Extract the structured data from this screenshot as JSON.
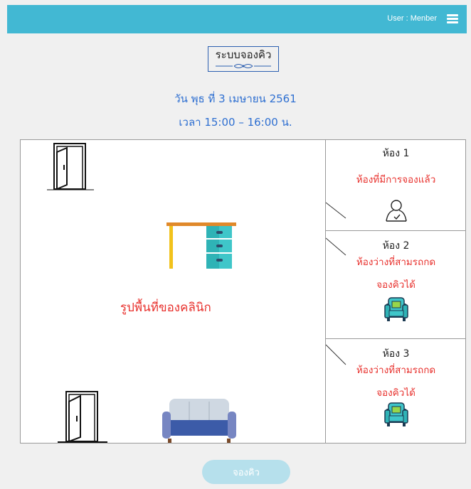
{
  "header": {
    "user_label": "User : Menber",
    "menu_icon": "hamburger-icon"
  },
  "title": "ระบบจองคิว",
  "date": "วัน พุธ ที่ 3 เมษายน 2561",
  "time": "เวลา 15:00 – 16:00 น.",
  "floor": {
    "label": "รูปพื้นที่ของคลินิก",
    "icons": [
      "door-icon",
      "desk-icon",
      "door-icon",
      "sofa-icon"
    ]
  },
  "rooms": [
    {
      "name": "ห้อง 1",
      "status": "ห้องที่มีการจองแล้ว",
      "icon": "user-icon"
    },
    {
      "name": "ห้อง 2",
      "status_line1": "ห้องว่างที่สามรถกด",
      "status_line2": "จองคิวได้",
      "icon": "armchair-icon"
    },
    {
      "name": "ห้อง 3",
      "status_line1": "ห้องว่างที่สามรถกด",
      "status_line2": "จองคิวได้",
      "icon": "armchair-icon"
    }
  ],
  "book_button": "จองคิว",
  "colors": {
    "topbar": "#42b8d3",
    "accent_text": "#2e6fd1",
    "status_red": "#e8312d",
    "button": "#b6e0ec"
  }
}
